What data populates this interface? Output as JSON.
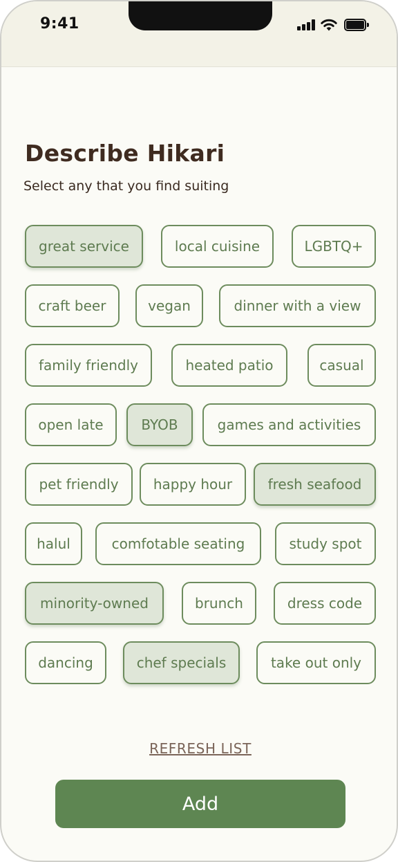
{
  "status_bar": {
    "time": "9:41"
  },
  "header": {
    "title": "Describe Hikari",
    "subtitle": "Select any that you find suiting"
  },
  "tags": [
    [
      {
        "label": "great service",
        "selected": true
      },
      {
        "label": "local cuisine",
        "selected": false
      },
      {
        "label": "LGBTQ+",
        "selected": false
      }
    ],
    [
      {
        "label": "craft beer",
        "selected": false
      },
      {
        "label": "vegan",
        "selected": false
      },
      {
        "label": "dinner with a view",
        "selected": false
      }
    ],
    [
      {
        "label": "family friendly",
        "selected": false
      },
      {
        "label": "heated patio",
        "selected": false
      },
      {
        "label": "casual",
        "selected": false
      }
    ],
    [
      {
        "label": "open late",
        "selected": false
      },
      {
        "label": "BYOB",
        "selected": true
      },
      {
        "label": "games and activities",
        "selected": false
      }
    ],
    [
      {
        "label": "pet friendly",
        "selected": false
      },
      {
        "label": "happy hour",
        "selected": false
      },
      {
        "label": "fresh seafood",
        "selected": true
      }
    ],
    [
      {
        "label": "halul",
        "selected": false
      },
      {
        "label": "comfotable seating",
        "selected": false
      },
      {
        "label": "study spot",
        "selected": false
      }
    ],
    [
      {
        "label": "minority-owned",
        "selected": true
      },
      {
        "label": "brunch",
        "selected": false
      },
      {
        "label": "dress code",
        "selected": false
      }
    ],
    [
      {
        "label": "dancing",
        "selected": false
      },
      {
        "label": "chef specials",
        "selected": true
      },
      {
        "label": "take out only",
        "selected": false
      }
    ]
  ],
  "actions": {
    "refresh_label": "REFRESH LIST",
    "add_label": "Add"
  },
  "colors": {
    "accent": "#5e8652",
    "tag_border": "#6d8c5d",
    "tag_selected_bg": "#dfe6d8",
    "title": "#3f2b20"
  }
}
